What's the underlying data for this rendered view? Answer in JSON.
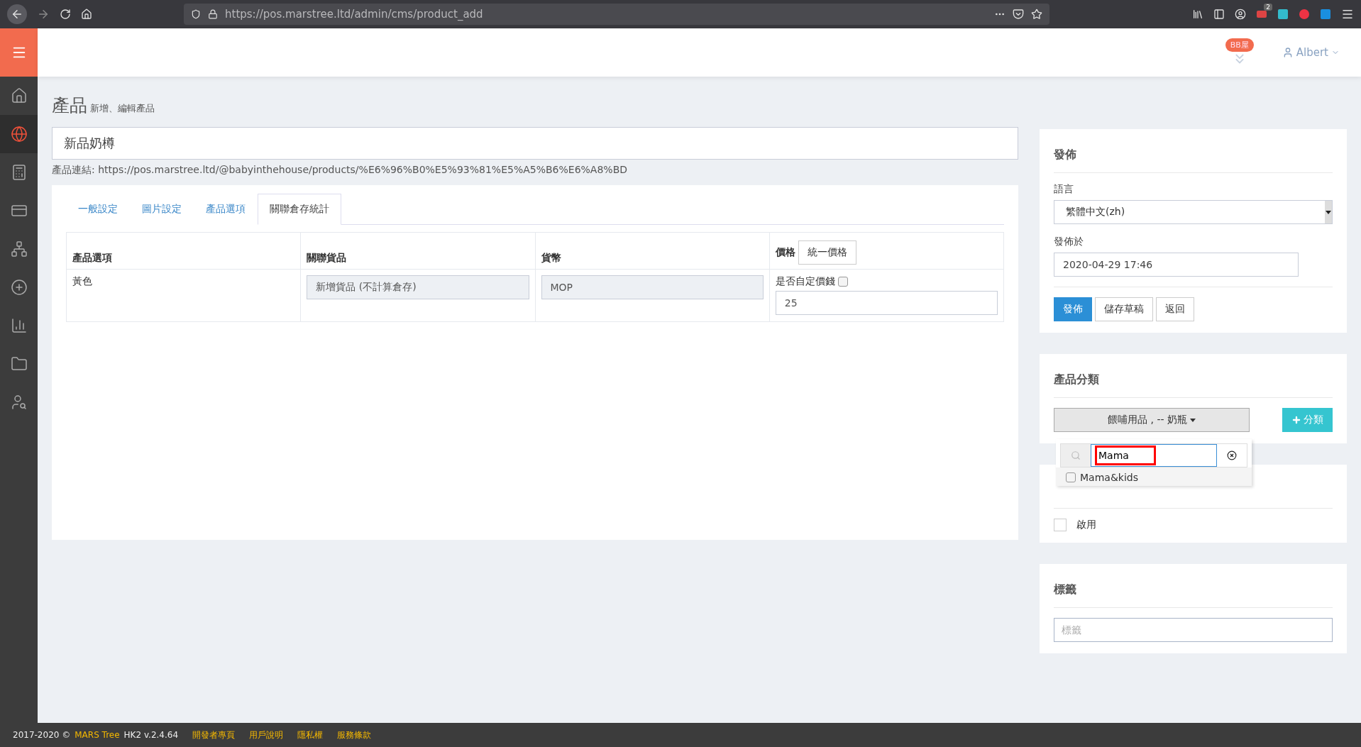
{
  "browser": {
    "url": "https://pos.marstree.ltd/admin/cms/product_add",
    "extension_badge": "2"
  },
  "sidebar": {
    "items": [
      {
        "selected": false
      },
      {
        "selected": true
      },
      {
        "selected": false
      },
      {
        "selected": false
      },
      {
        "selected": false
      },
      {
        "selected": false
      },
      {
        "selected": false
      },
      {
        "selected": false
      },
      {
        "selected": false
      }
    ]
  },
  "header": {
    "shop_badge": "BB屋",
    "user": "Albert"
  },
  "page": {
    "title": "產品",
    "subtitle": "新增、編輯產品"
  },
  "product_name": {
    "value": "新品奶樽"
  },
  "product_link": "產品連結: https://pos.marstree.ltd/@babyinthehouse/products/%E6%96%B0%E5%93%81%E5%A5%B6%E6%A8%BD",
  "tabs": [
    {
      "label": "一般設定",
      "selected": false
    },
    {
      "label": "圖片設定",
      "selected": false
    },
    {
      "label": "產品選項",
      "selected": false
    },
    {
      "label": "關聯倉存統計",
      "selected": true
    }
  ],
  "table": {
    "columns": [
      "產品選項",
      "關聯貨品",
      "貨幣",
      "價格"
    ],
    "header_button": "統一價格",
    "rows": [
      {
        "option": "黃色",
        "linked_goods": "新增貨品 (不計算倉存)",
        "currency": "MOP",
        "custom_price_label": "是否自定價錢",
        "custom_price": false,
        "price": "25"
      }
    ]
  },
  "publish": {
    "title": "發佈",
    "language_label": "語言",
    "language": "繁體中文(zh)",
    "published_at_label": "發佈於",
    "published_at": "2020-04-29 17:46",
    "buttons": [
      {
        "label": "發佈",
        "kind": "primary"
      },
      {
        "label": "儲存草稿",
        "kind": "default"
      },
      {
        "label": "返回",
        "kind": "default"
      }
    ]
  },
  "category": {
    "title": "產品分類",
    "dropdown": "餵哺用品 , -- 奶瓶",
    "add_button": "分類",
    "popup": {
      "search": "Mama",
      "highlighted": true,
      "options": [
        {
          "label": "Mama&kids",
          "checked": false
        }
      ]
    }
  },
  "status": {
    "enable": {
      "label": "啟用",
      "checked": false
    }
  },
  "tags": {
    "title": "標籤",
    "placeholder": "標籤"
  },
  "footer": {
    "copyright": "2017-2020 ©",
    "brand": "MARS Tree",
    "version": "HK2 v.2.4.64",
    "links": [
      "開發者專頁",
      "用戶說明",
      "隱私權",
      "服務條款"
    ]
  }
}
